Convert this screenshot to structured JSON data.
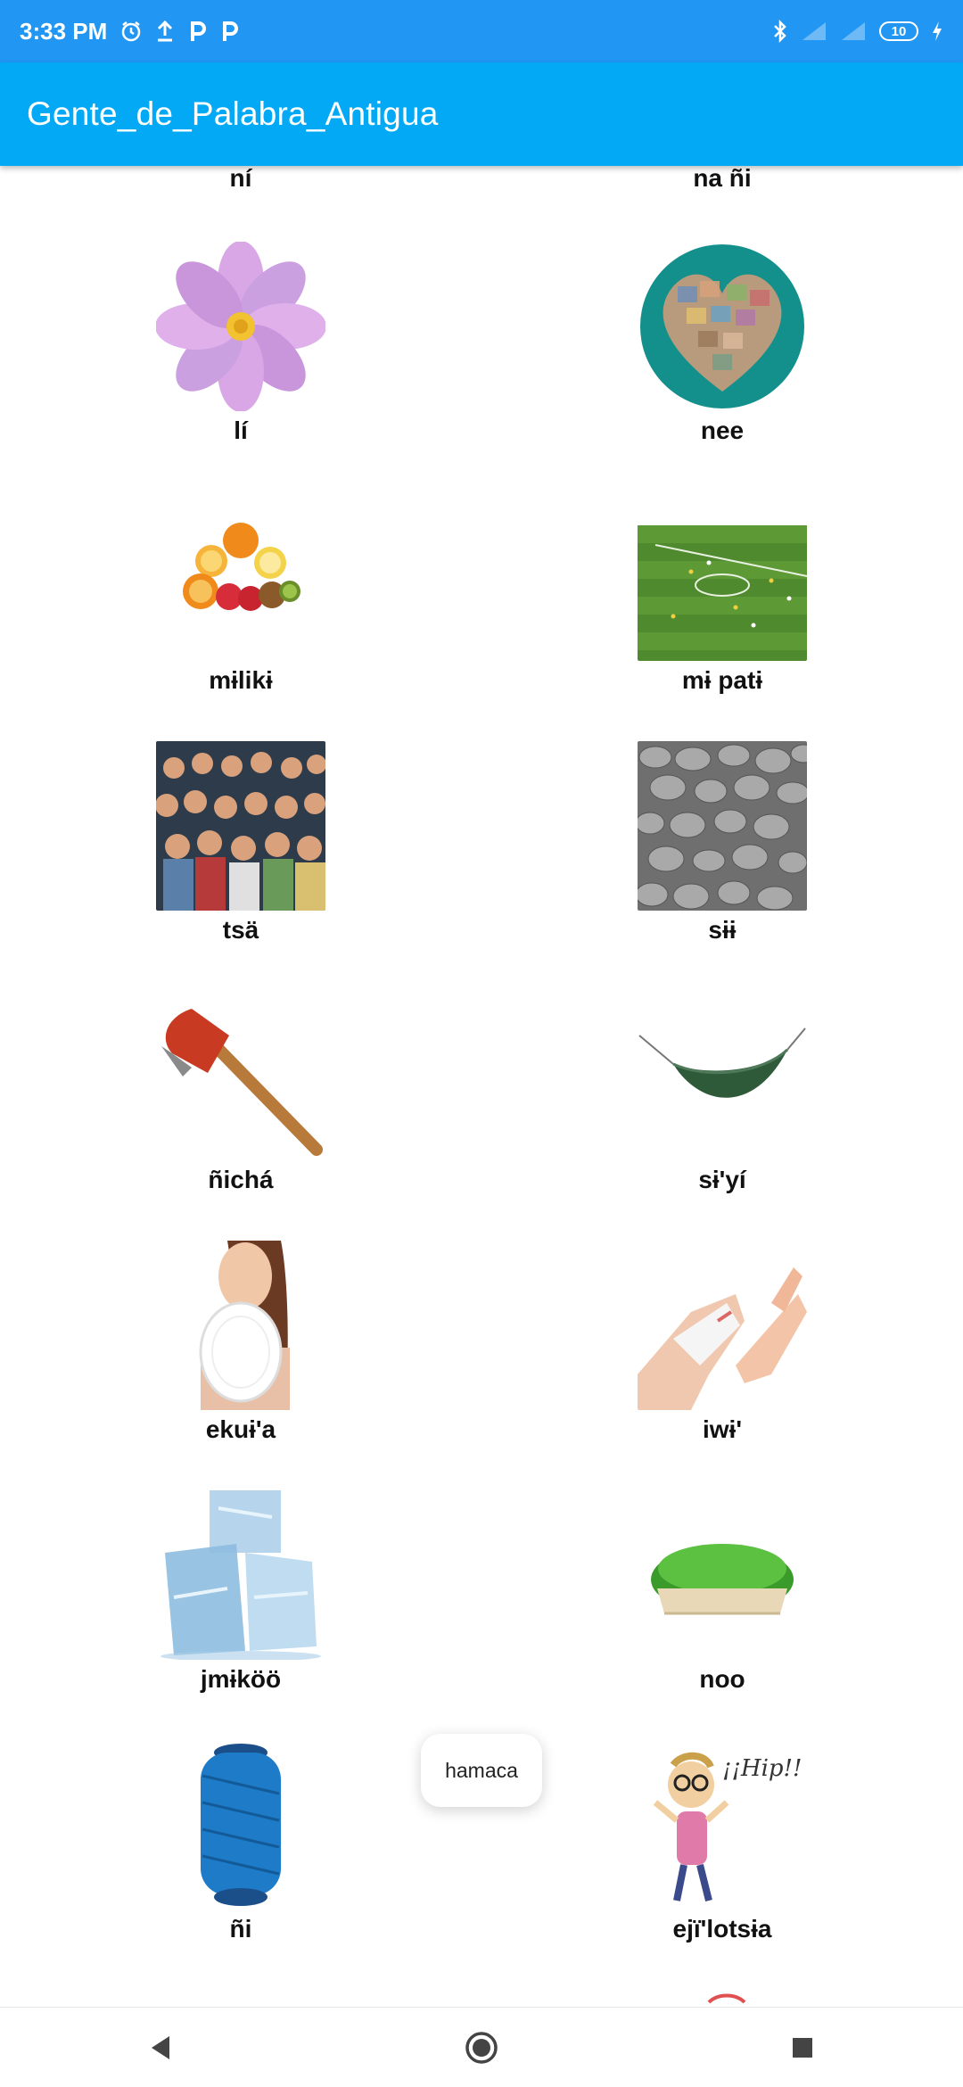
{
  "status_bar": {
    "time": "3:33 PM",
    "battery": "10",
    "icons": [
      "alarm-icon",
      "upload-icon",
      "p-notification-icon",
      "p-notification-icon",
      "bluetooth-icon",
      "signal-icon",
      "signal-icon",
      "battery-icon",
      "charging-icon"
    ]
  },
  "app_bar": {
    "title": "Gente_de_Palabra_Antigua"
  },
  "grid": {
    "items": [
      {
        "label": "ní",
        "image": "partial-image"
      },
      {
        "label": "na ñi",
        "image": "partial-image"
      },
      {
        "label": "lí",
        "image": "flower-image"
      },
      {
        "label": "nee",
        "image": "heart-photo-collage-image"
      },
      {
        "label": "mɨlikɨ",
        "image": "fruits-image"
      },
      {
        "label": "mɨ patɨ",
        "image": "soccer-field-image"
      },
      {
        "label": "tsä",
        "image": "crowd-of-people-image"
      },
      {
        "label": "sɨɨ",
        "image": "stones-image"
      },
      {
        "label": "ñichá",
        "image": "axe-image"
      },
      {
        "label": "sɨ'yí",
        "image": "hammock-image"
      },
      {
        "label": "ekuɨ'a",
        "image": "woman-with-plate-image"
      },
      {
        "label": "iwɨ'",
        "image": "bandaged-hand-image"
      },
      {
        "label": "jmɨköö",
        "image": "ice-cubes-image"
      },
      {
        "label": "noo",
        "image": "grass-image"
      },
      {
        "label": "ñi",
        "image": "blue-thread-spool-image"
      },
      {
        "label": "ejï'lotsɨa",
        "image": "cheering-cartoon-image"
      }
    ],
    "cartoon_caption": "¡¡Hip!!"
  },
  "toast": {
    "text": "hamaca"
  },
  "nav_bar": {
    "back": "back-icon",
    "home": "home-icon",
    "recents": "recents-icon"
  },
  "colors": {
    "status_bar": "#2196F3",
    "app_bar": "#03A9F4"
  }
}
